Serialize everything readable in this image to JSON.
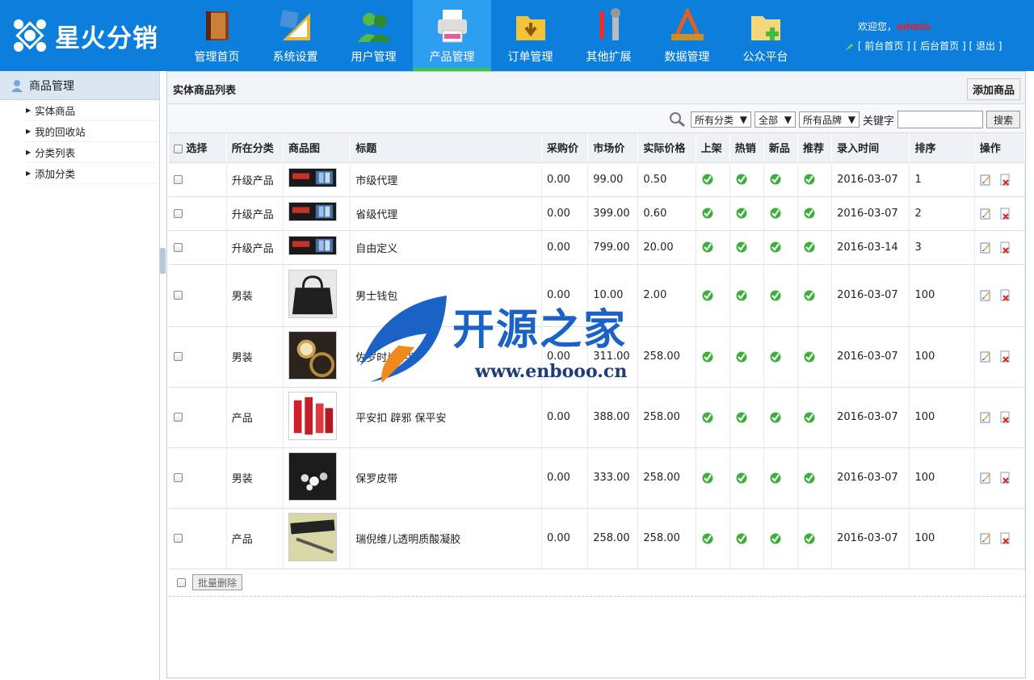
{
  "brand": {
    "name": "星火分销"
  },
  "nav": [
    {
      "label": "管理首页",
      "icon": "book-icon",
      "active": false
    },
    {
      "label": "系统设置",
      "icon": "ruler-icon",
      "active": false
    },
    {
      "label": "用户管理",
      "icon": "users-icon",
      "active": false
    },
    {
      "label": "产品管理",
      "icon": "printer-icon",
      "active": true
    },
    {
      "label": "订单管理",
      "icon": "folder-icon",
      "active": false
    },
    {
      "label": "其他扩展",
      "icon": "tools-icon",
      "active": false
    },
    {
      "label": "数据管理",
      "icon": "drafting-icon",
      "active": false
    },
    {
      "label": "公众平台",
      "icon": "folder-add-icon",
      "active": false
    }
  ],
  "user": {
    "welcome": "欢迎您，",
    "name": "admin",
    "front": "前台首页",
    "back": "后台首页",
    "logout": "退出"
  },
  "sidebar": {
    "title": "商品管理",
    "items": [
      {
        "label": "实体商品"
      },
      {
        "label": "我的回收站"
      },
      {
        "label": "分类列表"
      },
      {
        "label": "添加分类"
      }
    ]
  },
  "main": {
    "title": "实体商品列表",
    "add_label": "添加商品",
    "filters": {
      "category": "所有分类",
      "status": "全部",
      "brand": "所有品牌",
      "keyword_label": "关键字",
      "search_label": "搜索"
    },
    "headers": [
      "选择",
      "所在分类",
      "商品图",
      "标题",
      "采购价",
      "市场价",
      "实际价格",
      "上架",
      "热销",
      "新品",
      "推荐",
      "录入时间",
      "排序",
      "操作"
    ],
    "rows": [
      {
        "category": "升级产品",
        "title": "市级代理",
        "buy": "0.00",
        "market": "99.00",
        "real": "0.50",
        "date": "2016-03-07",
        "sort": "1",
        "img": "banner",
        "h": 42
      },
      {
        "category": "升级产品",
        "title": "省级代理",
        "buy": "0.00",
        "market": "399.00",
        "real": "0.60",
        "date": "2016-03-07",
        "sort": "2",
        "img": "banner",
        "h": 42
      },
      {
        "category": "升级产品",
        "title": "自由定义",
        "buy": "0.00",
        "market": "799.00",
        "real": "20.00",
        "date": "2016-03-14",
        "sort": "3",
        "img": "banner",
        "h": 42
      },
      {
        "category": "男装",
        "title": "男士钱包",
        "buy": "0.00",
        "market": "10.00",
        "real": "2.00",
        "date": "2016-03-07",
        "sort": "100",
        "img": "bag",
        "h": 77
      },
      {
        "category": "男装",
        "title": "佐罗时尚手链",
        "buy": "0.00",
        "market": "311.00",
        "real": "258.00",
        "date": "2016-03-07",
        "sort": "100",
        "img": "watch",
        "h": 75
      },
      {
        "category": "产品",
        "title": "平安扣 辟邪 保平安",
        "buy": "0.00",
        "market": "388.00",
        "real": "258.00",
        "date": "2016-03-07",
        "sort": "100",
        "img": "cosmetics",
        "h": 75
      },
      {
        "category": "男装",
        "title": "保罗皮带",
        "buy": "0.00",
        "market": "333.00",
        "real": "258.00",
        "date": "2016-03-07",
        "sort": "100",
        "img": "diamonds",
        "h": 75
      },
      {
        "category": "产品",
        "title": "瑞倪维儿透明质酸凝胶",
        "buy": "0.00",
        "market": "258.00",
        "real": "258.00",
        "date": "2016-03-07",
        "sort": "100",
        "img": "pen",
        "h": 75
      }
    ],
    "bulk_delete": "批量删除"
  },
  "watermark": {
    "text": "开源之家",
    "url": "www.enbooo.cn"
  }
}
